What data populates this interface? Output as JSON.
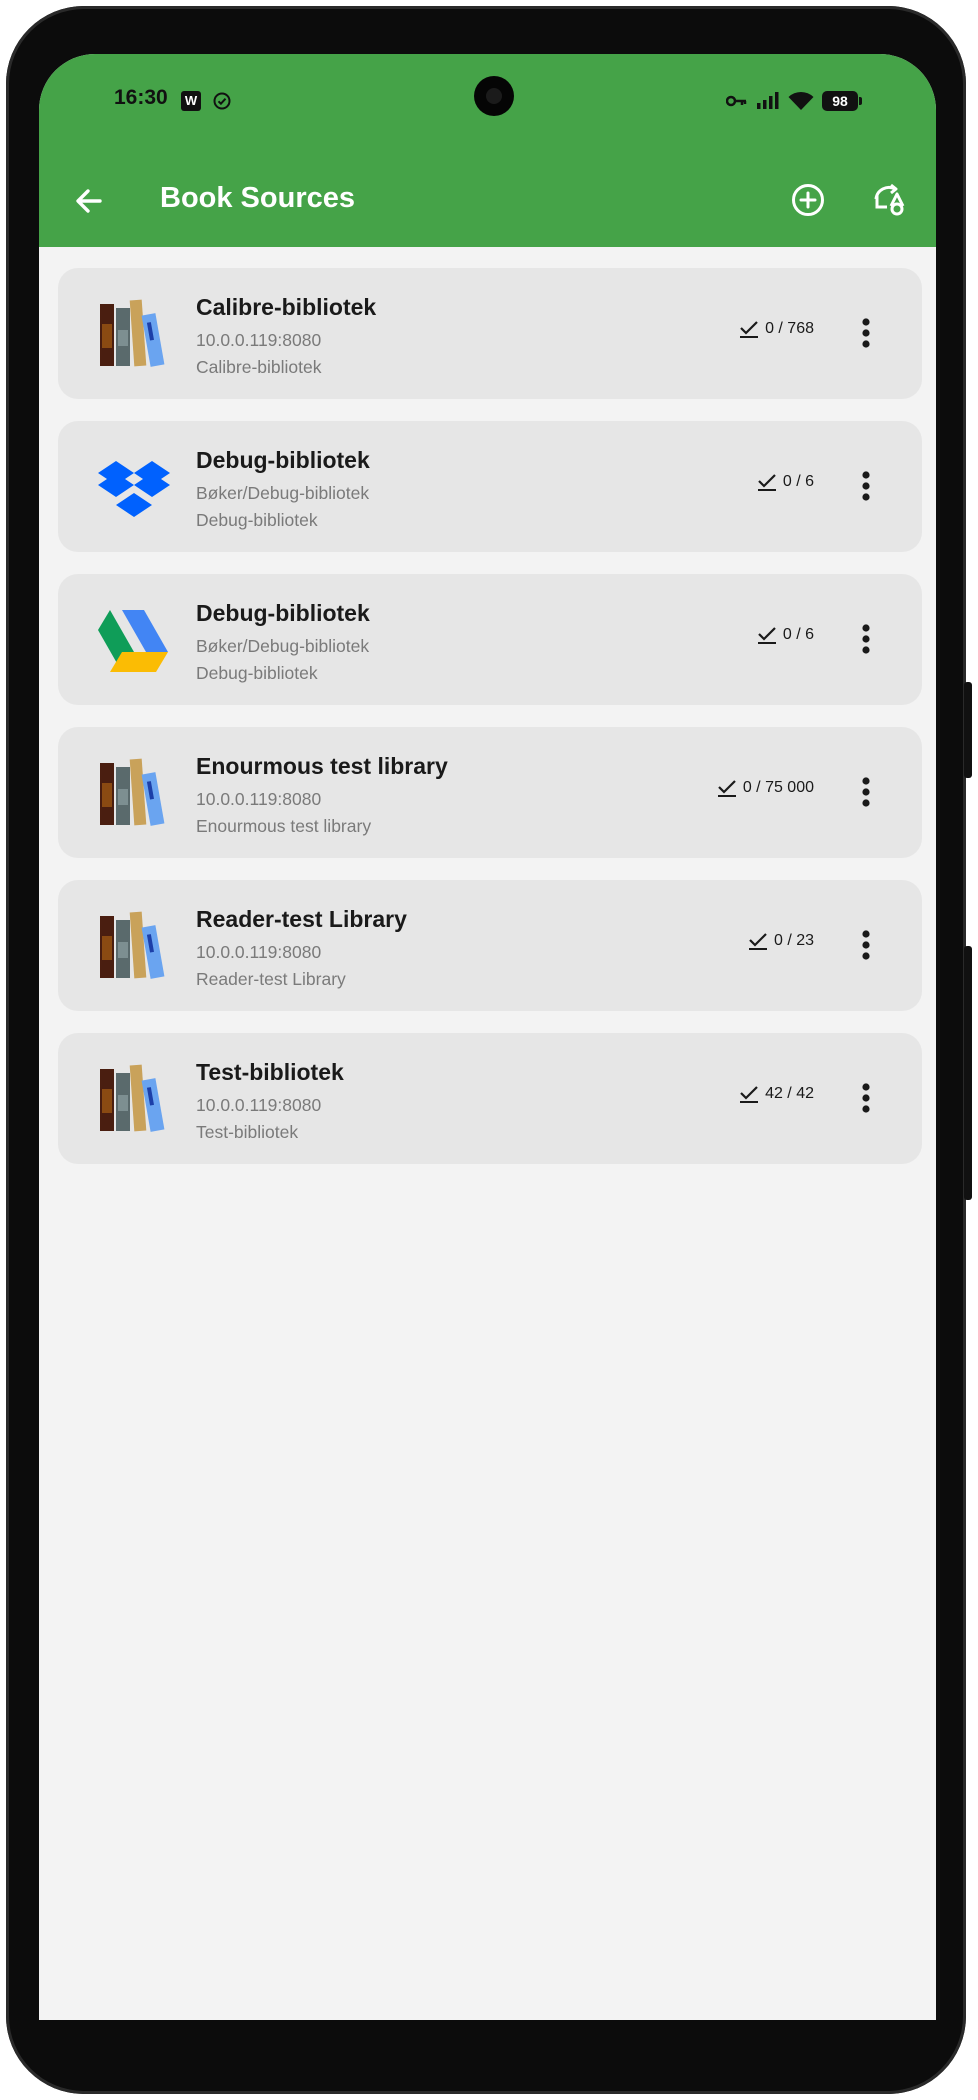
{
  "status_bar": {
    "time": "16:30",
    "notif_app_letter": "W",
    "battery_level": "98"
  },
  "app_bar": {
    "title": "Book Sources",
    "back_icon": "arrow-left-icon",
    "add_icon": "plus-circle-icon",
    "sync_icon": "sync-icon",
    "color": "#45a348"
  },
  "sources": [
    {
      "icon": "calibre",
      "title": "Calibre-bibliotek",
      "subtitle": "10.0.0.119:8080",
      "name": "Calibre-bibliotek",
      "progress": "0 / 768"
    },
    {
      "icon": "dropbox",
      "title": "Debug-bibliotek",
      "subtitle": "Bøker/Debug-bibliotek",
      "name": "Debug-bibliotek",
      "progress": "0 / 6"
    },
    {
      "icon": "google-drive",
      "title": "Debug-bibliotek",
      "subtitle": "Bøker/Debug-bibliotek",
      "name": "Debug-bibliotek",
      "progress": "0 / 6"
    },
    {
      "icon": "calibre",
      "title": "Enourmous test library",
      "subtitle": "10.0.0.119:8080",
      "name": "Enourmous test library",
      "progress": "0 / 75 000"
    },
    {
      "icon": "calibre",
      "title": "Reader-test Library",
      "subtitle": "10.0.0.119:8080",
      "name": "Reader-test Library",
      "progress": "0 / 23"
    },
    {
      "icon": "calibre",
      "title": "Test-bibliotek",
      "subtitle": "10.0.0.119:8080",
      "name": "Test-bibliotek",
      "progress": "42 / 42"
    }
  ]
}
